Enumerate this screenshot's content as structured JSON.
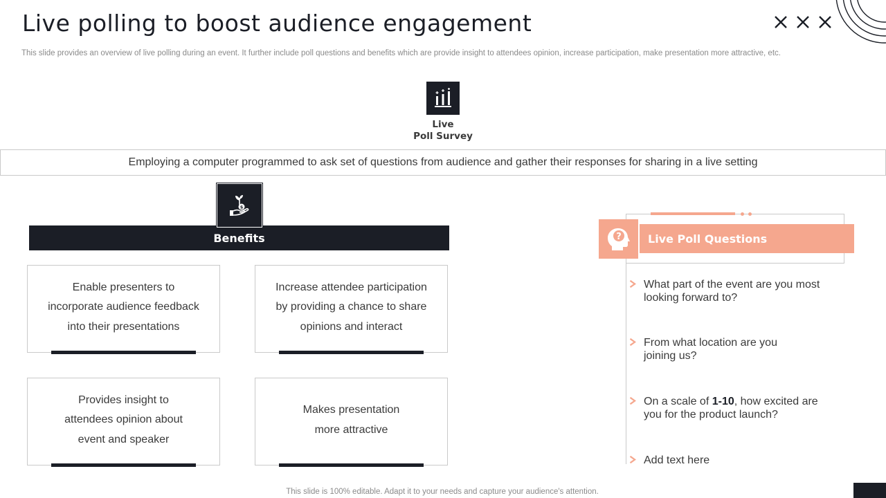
{
  "slide": {
    "title": "Live polling to boost audience engagement",
    "subtitle": "This slide provides an overview of live  polling during an event. It further include poll questions and benefits which are provide insight to attendees opinion, increase participation, make presentation more attractive, etc.",
    "footer": "This slide is 100% editable. Adapt it to your needs and capture your audience's attention."
  },
  "top_section": {
    "icon": "poll-bars-icon",
    "label_line1": "Live",
    "label_line2": "Poll Survey",
    "definition": "Employing a computer programmed to ask set of questions from audience and gather their responses for sharing in a live setting"
  },
  "benefits": {
    "icon": "money-plant-hand-icon",
    "heading": "Benefits",
    "cards": [
      {
        "line1": "Enable presenters to",
        "line2": "incorporate audience feedback",
        "line3": "into their presentations"
      },
      {
        "line1": "Increase  attendee participation",
        "line2": "by providing a chance to share",
        "line3": "opinions and interact"
      },
      {
        "line1": "Provides insight to",
        "line2": "attendees opinion about",
        "line3": "event and speaker"
      },
      {
        "line1": "Makes presentation",
        "line2": "more attractive",
        "line3": ""
      }
    ]
  },
  "poll_questions": {
    "icon": "head-question-icon",
    "heading": "Live Poll Questions",
    "items": [
      {
        "line1": "What part of the event  are you most",
        "line2": "looking forward to?"
      },
      {
        "line1": "From what location are you",
        "line2": "joining us?"
      },
      {
        "pre": "On a scale of ",
        "bold": "1-10",
        "post": ", how excited are",
        "line2": "you for the product launch?"
      },
      {
        "line1": "Add text here",
        "line2": ""
      }
    ]
  },
  "colors": {
    "dark": "#1b1e26",
    "accent": "#f5a78e",
    "border": "#c9c9c9"
  }
}
